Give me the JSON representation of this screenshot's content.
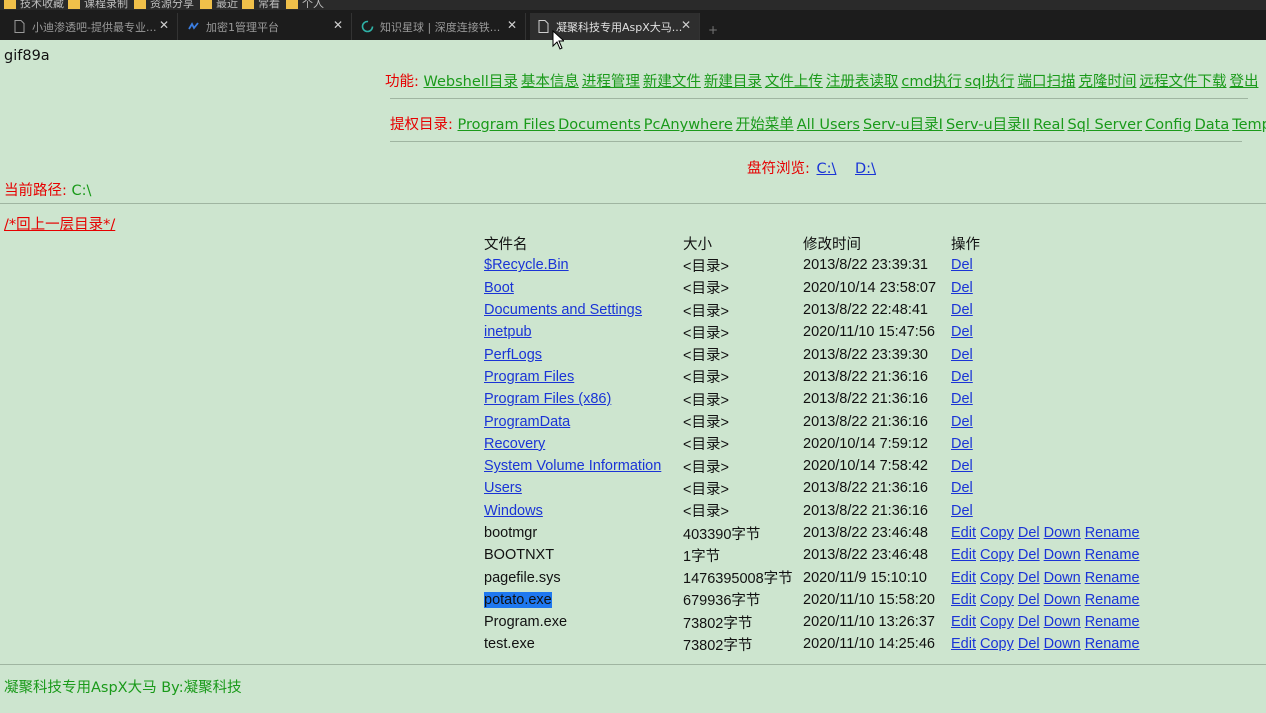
{
  "browser": {
    "bookmarks": [
      "技术收藏",
      "课程录制",
      "资源分享",
      "最近",
      "常看",
      "个人"
    ],
    "tabs": [
      {
        "title": "小迪渗透吧-提供最专业..."
      },
      {
        "title": "加密1管理平台"
      },
      {
        "title": "知识星球 | 深度连接铁..."
      },
      {
        "title": "凝聚科技专用AspX大马..."
      }
    ],
    "active_tab": 3,
    "new_tab": "+"
  },
  "page": {
    "header_text": "gif89a",
    "functions_label": "功能:",
    "functions": [
      "Webshell目录",
      "基本信息",
      "进程管理",
      "新建文件",
      "新建目录",
      "文件上传",
      "注册表读取",
      "cmd执行",
      "sql执行",
      "端口扫描",
      "克隆时间",
      "远程文件下载",
      "登出"
    ],
    "privesc_label": "提权目录:",
    "privesc_dirs": [
      "Program Files",
      "Documents",
      "PcAnywhere",
      "开始菜单",
      "All Users",
      "Serv-u目录I",
      "Serv-u目录II",
      "Real",
      "Sql Server",
      "Config",
      "Data",
      "Temp"
    ],
    "drives_label": "盘符浏览:",
    "drives": [
      "C:\\",
      "D:\\"
    ],
    "current_path_label": "当前路径:",
    "current_path": "C:\\",
    "up_dir": "/*回上一层目录*/",
    "columns": [
      "文件名",
      "大小",
      "修改时间",
      "操作"
    ],
    "dirs": [
      {
        "name": "$Recycle.Bin",
        "size": "<目录>",
        "time": "2013/8/22 23:39:31"
      },
      {
        "name": "Boot",
        "size": "<目录>",
        "time": "2020/10/14 23:58:07"
      },
      {
        "name": "Documents and Settings",
        "size": "<目录>",
        "time": "2013/8/22 22:48:41"
      },
      {
        "name": "inetpub",
        "size": "<目录>",
        "time": "2020/11/10 15:47:56"
      },
      {
        "name": "PerfLogs",
        "size": "<目录>",
        "time": "2013/8/22 23:39:30"
      },
      {
        "name": "Program Files",
        "size": "<目录>",
        "time": "2013/8/22 21:36:16"
      },
      {
        "name": "Program Files (x86)",
        "size": "<目录>",
        "time": "2013/8/22 21:36:16"
      },
      {
        "name": "ProgramData",
        "size": "<目录>",
        "time": "2013/8/22 21:36:16"
      },
      {
        "name": "Recovery",
        "size": "<目录>",
        "time": "2020/10/14 7:59:12"
      },
      {
        "name": "System Volume Information",
        "size": "<目录>",
        "time": "2020/10/14 7:58:42"
      },
      {
        "name": "Users",
        "size": "<目录>",
        "time": "2013/8/22 21:36:16"
      },
      {
        "name": "Windows",
        "size": "<目录>",
        "time": "2013/8/22 21:36:16"
      }
    ],
    "dir_action": "Del",
    "files": [
      {
        "name": "bootmgr",
        "size": "403390字节",
        "time": "2013/8/22 23:46:48",
        "selected": false
      },
      {
        "name": "BOOTNXT",
        "size": "1字节",
        "time": "2013/8/22 23:46:48",
        "selected": false
      },
      {
        "name": "pagefile.sys",
        "size": "1476395008字节",
        "time": "2020/11/9 15:10:10",
        "selected": false
      },
      {
        "name": "potato.exe",
        "size": "679936字节",
        "time": "2020/11/10 15:58:20",
        "selected": true
      },
      {
        "name": "Program.exe",
        "size": "73802字节",
        "time": "2020/11/10 13:26:37",
        "selected": false
      },
      {
        "name": "test.exe",
        "size": "73802字节",
        "time": "2020/11/10 14:25:46",
        "selected": false
      }
    ],
    "file_actions": [
      "Edit",
      "Copy",
      "Del",
      "Down",
      "Rename"
    ],
    "footer": "凝聚科技专用AspX大马 By:凝聚科技"
  }
}
